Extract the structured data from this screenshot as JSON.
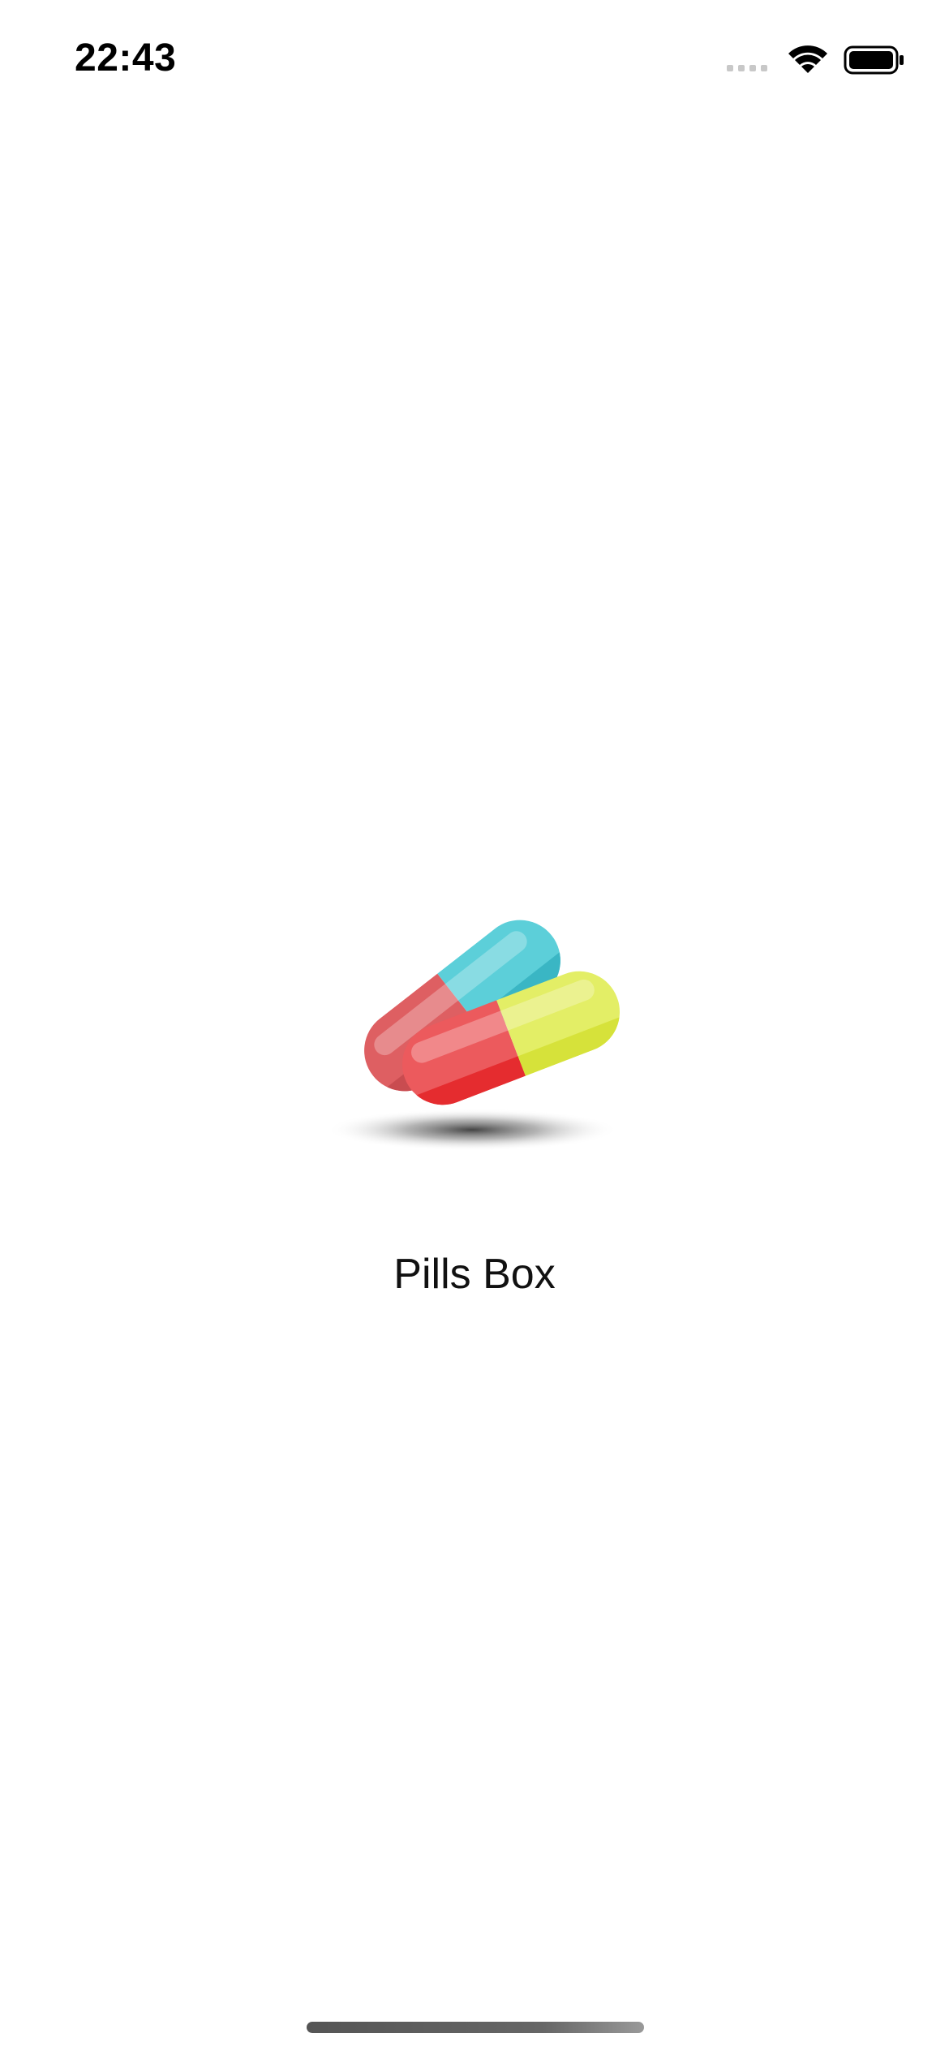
{
  "status_bar": {
    "time": "22:43",
    "icons": [
      "cellular-signal-icon",
      "wifi-icon",
      "battery-icon"
    ]
  },
  "splash": {
    "logo_icon": "pills-capsules-icon",
    "app_name": "Pills Box"
  },
  "colors": {
    "background": "#ffffff",
    "capsule_red": "#e8585c",
    "capsule_cyan": "#56c9d6",
    "capsule_yellow": "#e2ee60",
    "text": "#111111"
  }
}
